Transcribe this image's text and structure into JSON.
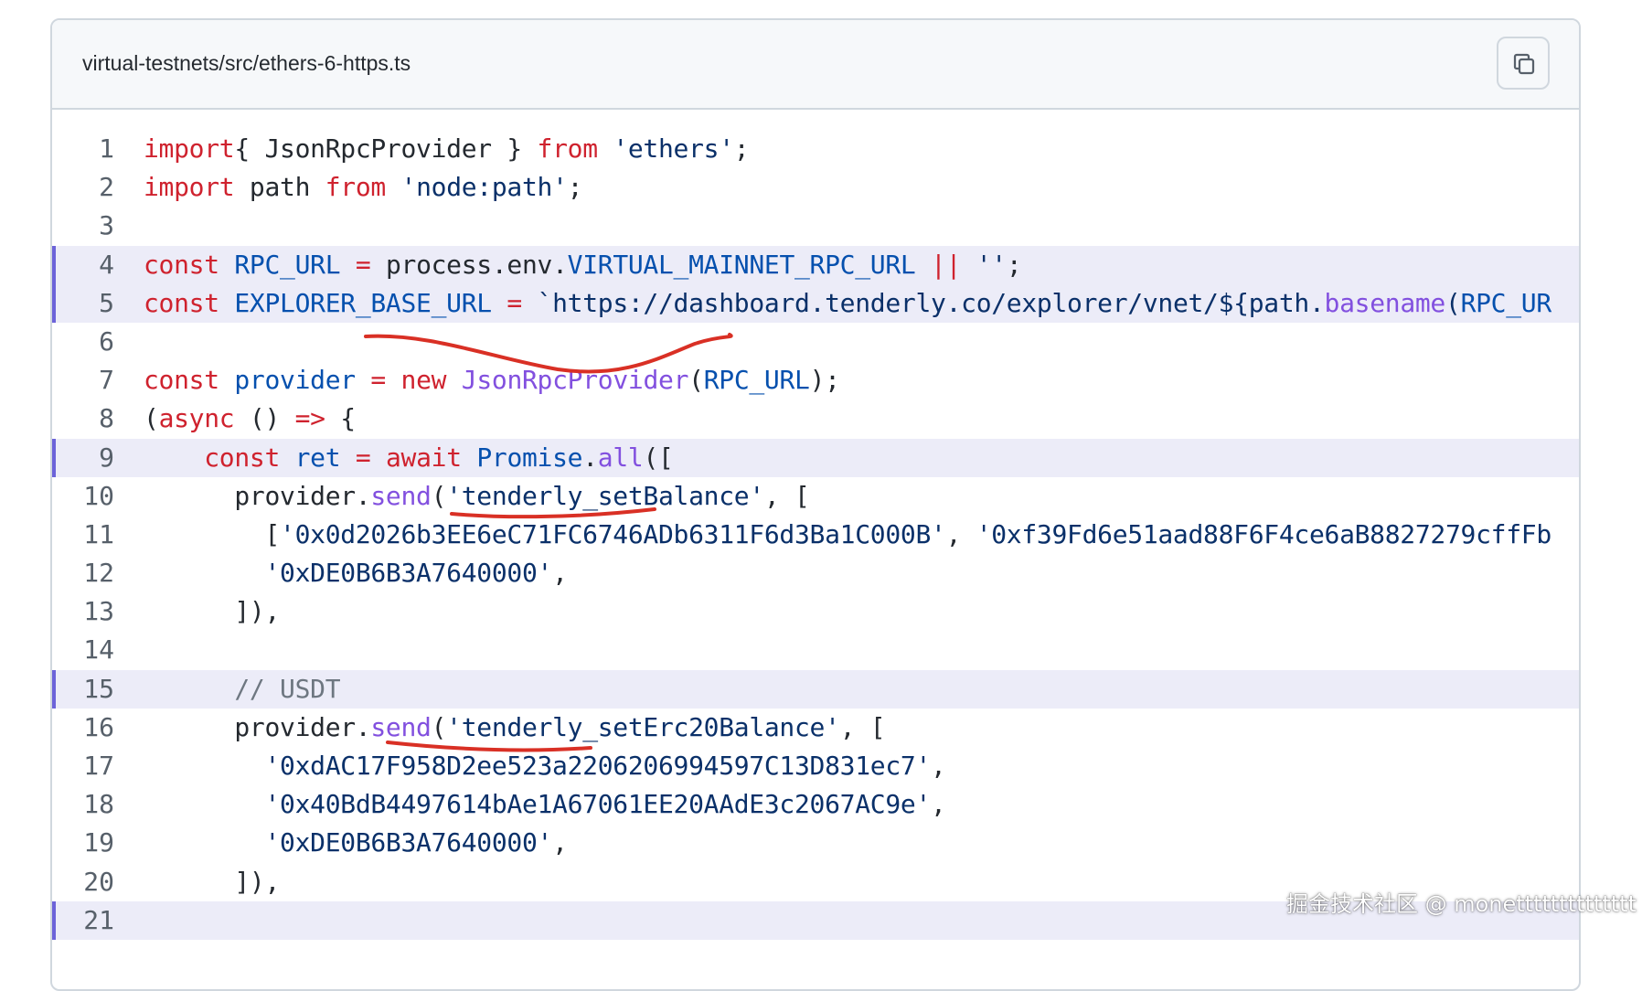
{
  "file": {
    "path": "virtual-testnets/src/ethers-6-https.ts",
    "copy_icon": "copy-icon"
  },
  "code_lines": [
    {
      "num": "1",
      "tokens": [
        [
          "kw",
          "import"
        ],
        [
          "",
          "{ JsonRpcProvider } "
        ],
        [
          "kw",
          "from"
        ],
        [
          "",
          " "
        ],
        [
          "str",
          "'ethers'"
        ],
        [
          "",
          ";"
        ]
      ]
    },
    {
      "num": "2",
      "tokens": [
        [
          "kw",
          "import"
        ],
        [
          "",
          " path "
        ],
        [
          "kw",
          "from"
        ],
        [
          "",
          " "
        ],
        [
          "str",
          "'node:path'"
        ],
        [
          "",
          ";"
        ]
      ]
    },
    {
      "num": "3",
      "tokens": []
    },
    {
      "num": "4",
      "highlight": true,
      "tokens": [
        [
          "kw",
          "const"
        ],
        [
          "",
          " "
        ],
        [
          "var",
          "RPC_URL"
        ],
        [
          "",
          " "
        ],
        [
          "op",
          "="
        ],
        [
          "",
          " process.env."
        ],
        [
          "var",
          "VIRTUAL_MAINNET_RPC_URL"
        ],
        [
          "",
          " "
        ],
        [
          "op",
          "||"
        ],
        [
          "",
          " "
        ],
        [
          "str",
          "''"
        ],
        [
          "",
          ";"
        ]
      ]
    },
    {
      "num": "5",
      "highlight": true,
      "tokens": [
        [
          "kw",
          "const"
        ],
        [
          "",
          " "
        ],
        [
          "var",
          "EXPLORER_BASE_URL"
        ],
        [
          "",
          " "
        ],
        [
          "op",
          "="
        ],
        [
          "",
          " "
        ],
        [
          "str",
          "`https://dashboard.tenderly.co/explorer/vnet/${path."
        ],
        [
          "fn",
          "basename"
        ],
        [
          "str",
          "("
        ],
        [
          "var",
          "RPC_UR"
        ]
      ]
    },
    {
      "num": "6",
      "tokens": []
    },
    {
      "num": "7",
      "tokens": [
        [
          "kw",
          "const"
        ],
        [
          "",
          " "
        ],
        [
          "var",
          "provider"
        ],
        [
          "",
          " "
        ],
        [
          "op",
          "="
        ],
        [
          "",
          " "
        ],
        [
          "kw",
          "new"
        ],
        [
          "",
          " "
        ],
        [
          "fn",
          "JsonRpcProvider"
        ],
        [
          "",
          "("
        ],
        [
          "var",
          "RPC_URL"
        ],
        [
          "",
          ");"
        ]
      ]
    },
    {
      "num": "8",
      "tokens": [
        [
          "",
          "("
        ],
        [
          "kw",
          "async"
        ],
        [
          "",
          " () "
        ],
        [
          "op",
          "=>"
        ],
        [
          "",
          " {"
        ]
      ]
    },
    {
      "num": "9",
      "highlight": true,
      "tokens": [
        [
          "",
          "    "
        ],
        [
          "kw",
          "const"
        ],
        [
          "",
          " "
        ],
        [
          "var",
          "ret"
        ],
        [
          "",
          " "
        ],
        [
          "op",
          "="
        ],
        [
          "",
          " "
        ],
        [
          "kw",
          "await"
        ],
        [
          "",
          " "
        ],
        [
          "var",
          "Promise"
        ],
        [
          "",
          "."
        ],
        [
          "fn",
          "all"
        ],
        [
          "",
          "(["
        ]
      ]
    },
    {
      "num": "10",
      "tokens": [
        [
          "",
          "      provider."
        ],
        [
          "fn",
          "send"
        ],
        [
          "",
          "("
        ],
        [
          "str",
          "'tenderly_setBalance'"
        ],
        [
          "",
          ", ["
        ]
      ]
    },
    {
      "num": "11",
      "tokens": [
        [
          "",
          "        ["
        ],
        [
          "str",
          "'0x0d2026b3EE6eC71FC6746ADb6311F6d3Ba1C000B'"
        ],
        [
          "",
          ", "
        ],
        [
          "str",
          "'0xf39Fd6e51aad88F6F4ce6aB8827279cffFb"
        ]
      ]
    },
    {
      "num": "12",
      "tokens": [
        [
          "",
          "        "
        ],
        [
          "str",
          "'0xDE0B6B3A7640000'"
        ],
        [
          "",
          ","
        ]
      ]
    },
    {
      "num": "13",
      "tokens": [
        [
          "",
          "      ]),"
        ]
      ]
    },
    {
      "num": "14",
      "tokens": []
    },
    {
      "num": "15",
      "highlight": true,
      "tokens": [
        [
          "",
          "      "
        ],
        [
          "cm",
          "// USDT"
        ]
      ]
    },
    {
      "num": "16",
      "tokens": [
        [
          "",
          "      provider."
        ],
        [
          "fn",
          "send"
        ],
        [
          "",
          "("
        ],
        [
          "str",
          "'tenderly_setErc20Balance'"
        ],
        [
          "",
          ", ["
        ]
      ]
    },
    {
      "num": "17",
      "tokens": [
        [
          "",
          "        "
        ],
        [
          "str",
          "'0xdAC17F958D2ee523a2206206994597C13D831ec7'"
        ],
        [
          "",
          ","
        ]
      ]
    },
    {
      "num": "18",
      "tokens": [
        [
          "",
          "        "
        ],
        [
          "str",
          "'0x40BdB4497614bAe1A67061EE20AAdE3c2067AC9e'"
        ],
        [
          "",
          ","
        ]
      ]
    },
    {
      "num": "19",
      "tokens": [
        [
          "",
          "        "
        ],
        [
          "str",
          "'0xDE0B6B3A7640000'"
        ],
        [
          "",
          ","
        ]
      ]
    },
    {
      "num": "20",
      "tokens": [
        [
          "",
          "      ]),"
        ]
      ]
    },
    {
      "num": "21",
      "highlight": true,
      "tokens": []
    }
  ],
  "colors": {
    "keyword": "#cf222e",
    "string": "#0a3069",
    "function": "#8250df",
    "variable": "#0550ae",
    "comment": "#6e7781",
    "highlight_bg": "#ececf8",
    "highlight_bar": "#6c63d9",
    "annotation": "#d93025"
  },
  "watermark": "掘金技术社区 @ monetttttttttttttt"
}
